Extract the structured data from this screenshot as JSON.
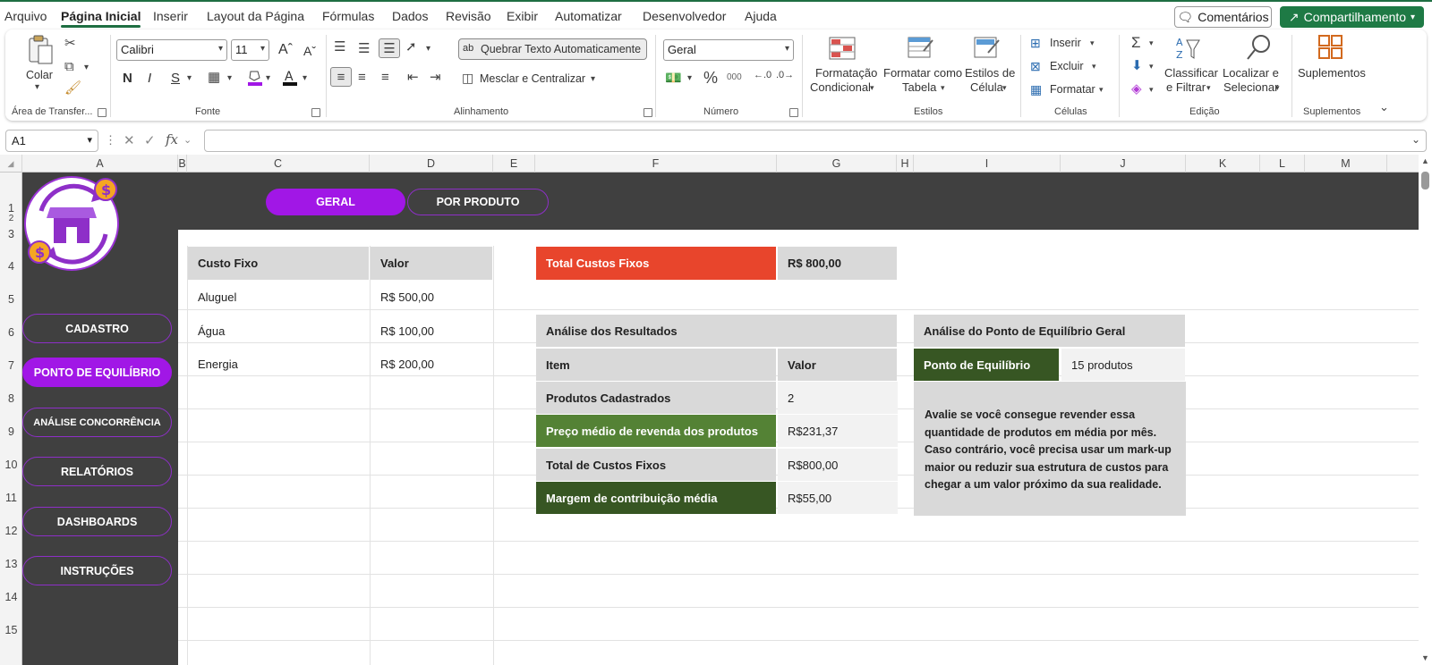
{
  "menu": {
    "items": [
      "Arquivo",
      "Página Inicial",
      "Inserir",
      "Layout da Página",
      "Fórmulas",
      "Dados",
      "Revisão",
      "Exibir",
      "Automatizar",
      "Desenvolvedor",
      "Ajuda"
    ],
    "comments_label": "Comentários",
    "share_label": "Compartilhamento"
  },
  "ribbon": {
    "clipboard": {
      "paste": "Colar",
      "group": "Área de Transfer..."
    },
    "font": {
      "name": "Calibri",
      "size": "11",
      "bold": "N",
      "italic": "I",
      "underline": "S",
      "group": "Fonte"
    },
    "alignment": {
      "wrap": "Quebrar Texto Automaticamente",
      "merge": "Mesclar e Centralizar",
      "group": "Alinhamento"
    },
    "number": {
      "format": "Geral",
      "group": "Número"
    },
    "styles": {
      "cond1": "Formatação",
      "cond2": "Condicional",
      "table1": "Formatar como",
      "table2": "Tabela",
      "cell1": "Estilos de",
      "cell2": "Célula",
      "group": "Estilos"
    },
    "cells": {
      "insert": "Inserir",
      "delete": "Excluir",
      "format": "Formatar",
      "group": "Células"
    },
    "editing": {
      "sort1": "Classificar",
      "sort2": "e Filtrar",
      "find1": "Localizar e",
      "find2": "Selecionar",
      "group": "Edição"
    },
    "addins": {
      "label": "Suplementos",
      "group": "Suplementos"
    }
  },
  "formula_bar": {
    "name_box": "A1",
    "fx": "fx",
    "formula": ""
  },
  "columns": [
    "A",
    "B",
    "C",
    "D",
    "E",
    "F",
    "G",
    "H",
    "I",
    "J",
    "K",
    "L",
    "M"
  ],
  "rows": [
    "1",
    "2",
    "3",
    "4",
    "5",
    "6",
    "7",
    "8",
    "9",
    "10",
    "11",
    "12",
    "13",
    "14",
    "15"
  ],
  "tabs": {
    "geral": "GERAL",
    "por_produto": "POR PRODUTO"
  },
  "sidebar": {
    "items": [
      "CADASTRO",
      "PONTO DE EQUILÍBRIO",
      "ANÁLISE CONCORRÊNCIA",
      "RELATÓRIOS",
      "DASHBOARDS",
      "INSTRUÇÕES"
    ]
  },
  "fixed_costs": {
    "header_item": "Custo Fixo",
    "header_value": "Valor",
    "rows": [
      {
        "item": "Aluguel",
        "value": "R$ 500,00"
      },
      {
        "item": "Água",
        "value": "R$ 100,00"
      },
      {
        "item": "Energia",
        "value": "R$ 200,00"
      }
    ]
  },
  "total_fixed": {
    "label": "Total Custos Fixos",
    "value": "R$ 800,00"
  },
  "analysis": {
    "title": "Análise dos Resultados",
    "header_item": "Item",
    "header_value": "Valor",
    "rows": [
      {
        "item": "Produtos Cadastrados",
        "value": "2"
      },
      {
        "item": "Preço médio de revenda dos produtos",
        "value": "R$231,37"
      },
      {
        "item": "Total de Custos Fixos",
        "value": "R$800,00"
      },
      {
        "item": "Margem de contribuição média",
        "value": "R$55,00"
      }
    ]
  },
  "breakeven": {
    "title": "Análise do Ponto de Equilíbrio Geral",
    "label": "Ponto de Equilíbrio",
    "value": "15 produtos",
    "note_lines": [
      "Avalie se você consegue revender essa",
      "quantidade de produtos em média por mês.",
      "Caso contrário, você precisa usar um mark-up",
      "maior ou reduzir sua estrutura de custos para",
      "chegar a um valor próximo da sua realidade."
    ]
  },
  "colors": {
    "accent_purple": "#a117e6",
    "dark_bg": "#404040",
    "red": "#e8452c",
    "green_light": "#548235",
    "green_dark": "#375623",
    "excel_green": "#1e7a45"
  }
}
